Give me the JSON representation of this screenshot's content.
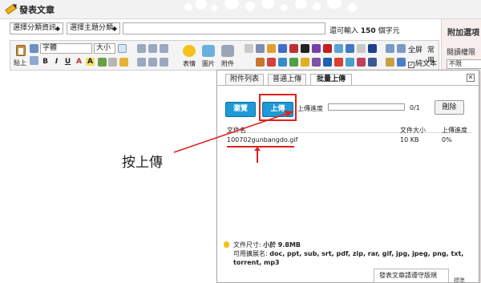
{
  "header": {
    "title": "發表文章"
  },
  "selects": {
    "category": "選擇分類資訊",
    "theme": "選擇主題分類"
  },
  "title_field": {
    "value": ""
  },
  "char_limit": {
    "prefix": "還可輸入",
    "count": "150",
    "suffix": "個字元"
  },
  "right_panel": {
    "heading": "附加選項",
    "label": "閱讀權限",
    "select_value": "不限"
  },
  "toolbar": {
    "paste": "貼上",
    "font": "字體",
    "size": "大小",
    "format_buttons": [
      "B",
      "I",
      "U",
      "A",
      "A"
    ],
    "emoji": "表情",
    "image": "圖片",
    "attachment": "附件",
    "fullscreen": "全屏",
    "common": "常用",
    "plaintext": "純文本",
    "plaintext_checked": true
  },
  "dialog": {
    "tabs": [
      "附件列表",
      "普通上傳",
      "批量上傳"
    ],
    "active_tab": 2,
    "browse": "瀏覽",
    "upload": "上傳",
    "progress_label": "上傳進度",
    "progress_count": "0/1",
    "progress_fraction": 0,
    "delete": "刪除",
    "columns": [
      "文件名",
      "文件大小",
      "上傳進度"
    ],
    "files": [
      {
        "name": "100702gunbangdo.gif",
        "size": "10 KB",
        "progress": "0%"
      }
    ],
    "max_size_label": "文件尺寸:",
    "max_size_prefix": "小於",
    "max_size": "9.8MB",
    "ext_label": "可用擴展名:",
    "extensions": "doc, ppt, sub, srt, pdf, zip, rar, gif, jpg, jpeg, png, txt, torrent, mp3"
  },
  "tooltip": "發表文章請遵守版規",
  "bottom_right": "標準",
  "annotation": "按上傳",
  "colors": {
    "accent_blue": "#1e9ad6",
    "annotation_red": "#e02020",
    "panel_pink": "#f9eeee"
  }
}
